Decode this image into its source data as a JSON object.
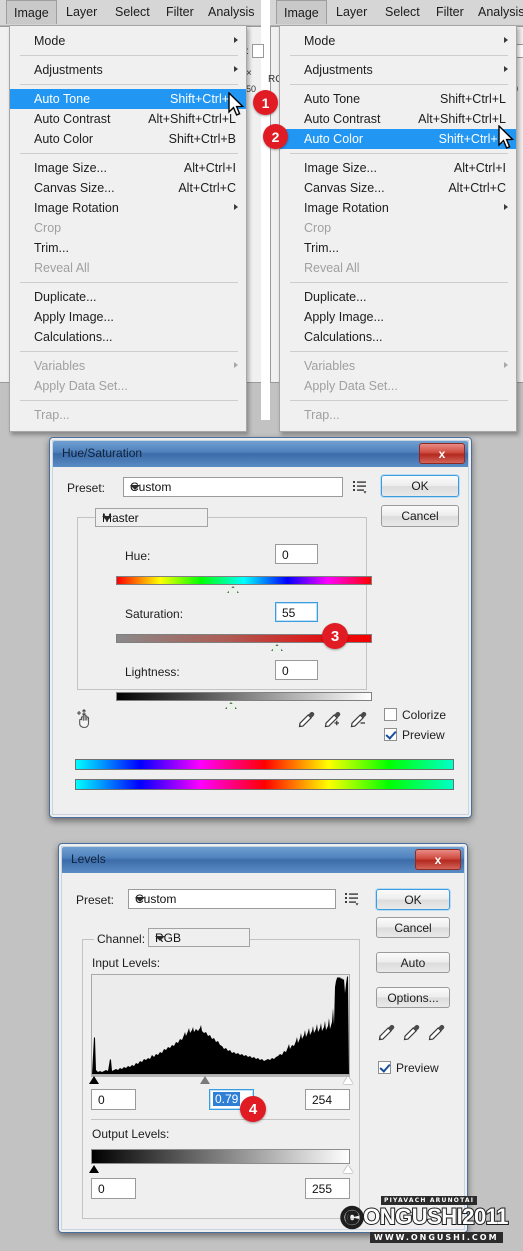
{
  "background_color": "#c2c2c2",
  "accent_color": "#2196f3",
  "badge_color": "#e01b24",
  "menubar": {
    "items": [
      "Image",
      "Layer",
      "Select",
      "Filter",
      "Analysis"
    ],
    "active_item": "Image"
  },
  "menu_left": {
    "title": "Image",
    "selected": "Auto Tone",
    "groups": [
      [
        {
          "label": "Mode",
          "shortcut": "",
          "submenu": true,
          "disabled": false
        }
      ],
      [
        {
          "label": "Adjustments",
          "shortcut": "",
          "submenu": true,
          "disabled": false
        }
      ],
      [
        {
          "label": "Auto Tone",
          "shortcut": "Shift+Ctrl+L",
          "submenu": false,
          "disabled": false
        },
        {
          "label": "Auto Contrast",
          "shortcut": "Alt+Shift+Ctrl+L",
          "submenu": false,
          "disabled": false
        },
        {
          "label": "Auto Color",
          "shortcut": "Shift+Ctrl+B",
          "submenu": false,
          "disabled": false
        }
      ],
      [
        {
          "label": "Image Size...",
          "shortcut": "Alt+Ctrl+I",
          "submenu": false,
          "disabled": false
        },
        {
          "label": "Canvas Size...",
          "shortcut": "Alt+Ctrl+C",
          "submenu": false,
          "disabled": false
        },
        {
          "label": "Image Rotation",
          "shortcut": "",
          "submenu": true,
          "disabled": false
        },
        {
          "label": "Crop",
          "shortcut": "",
          "submenu": false,
          "disabled": true
        },
        {
          "label": "Trim...",
          "shortcut": "",
          "submenu": false,
          "disabled": false
        },
        {
          "label": "Reveal All",
          "shortcut": "",
          "submenu": false,
          "disabled": true
        }
      ],
      [
        {
          "label": "Duplicate...",
          "shortcut": "",
          "submenu": false,
          "disabled": false
        },
        {
          "label": "Apply Image...",
          "shortcut": "",
          "submenu": false,
          "disabled": false
        },
        {
          "label": "Calculations...",
          "shortcut": "",
          "submenu": false,
          "disabled": false
        }
      ],
      [
        {
          "label": "Variables",
          "shortcut": "",
          "submenu": true,
          "disabled": true
        },
        {
          "label": "Apply Data Set...",
          "shortcut": "",
          "submenu": false,
          "disabled": true
        }
      ],
      [
        {
          "label": "Trap...",
          "shortcut": "",
          "submenu": false,
          "disabled": true
        }
      ]
    ]
  },
  "menu_right": {
    "title": "Image",
    "selected": "Auto Color"
  },
  "badges": [
    {
      "number": "1",
      "target": "auto-tone"
    },
    {
      "number": "2",
      "target": "auto-color"
    },
    {
      "number": "3",
      "target": "saturation-slider"
    },
    {
      "number": "4",
      "target": "gamma-input"
    }
  ],
  "hue_saturation": {
    "title": "Hue/Saturation",
    "close_label": "x",
    "preset_label": "Preset:",
    "preset_value": "Custom",
    "channel_value": "Master",
    "hue_label": "Hue:",
    "hue_value": "0",
    "saturation_label": "Saturation:",
    "saturation_value": "55",
    "lightness_label": "Lightness:",
    "lightness_value": "0",
    "ok_label": "OK",
    "cancel_label": "Cancel",
    "colorize_label": "Colorize",
    "colorize_checked": false,
    "preview_label": "Preview",
    "preview_checked": true
  },
  "levels": {
    "title": "Levels",
    "close_label": "x",
    "preset_label": "Preset:",
    "preset_value": "Custom",
    "channel_label": "Channel:",
    "channel_value": "RGB",
    "input_levels_label": "Input Levels:",
    "input_black": "0",
    "input_gamma": "0.79",
    "input_white": "254",
    "output_levels_label": "Output Levels:",
    "output_black": "0",
    "output_white": "255",
    "ok_label": "OK",
    "cancel_label": "Cancel",
    "auto_label": "Auto",
    "options_label": "Options...",
    "preview_label": "Preview",
    "preview_checked": true
  },
  "watermark": {
    "author": "PIYAVACH ARUNOTAI",
    "brand": "ONGUSHI2011",
    "site": "WWW.ONGUSHI.COM"
  }
}
